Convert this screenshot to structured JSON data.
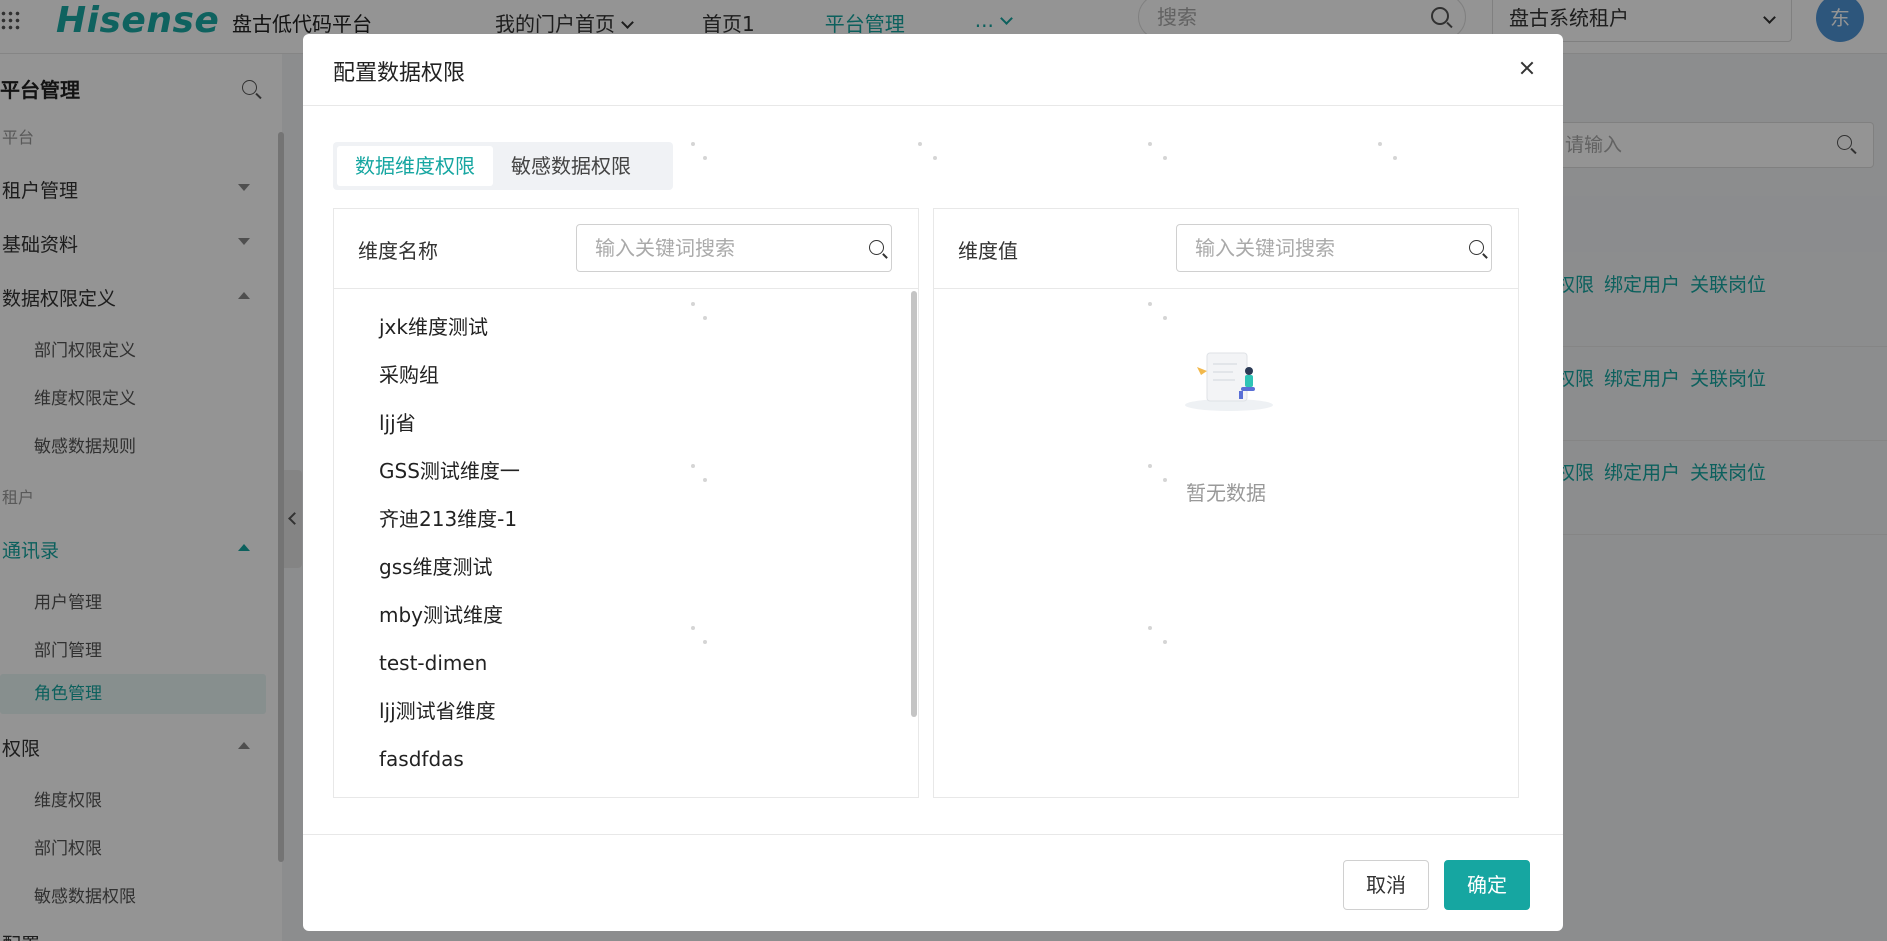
{
  "app": {
    "logo": "Hisense",
    "platform_name": "盘古低代码平台",
    "nav": [
      {
        "label": "我的门户首页",
        "has_dropdown": true,
        "active": false
      },
      {
        "label": "首页1",
        "has_dropdown": false,
        "active": false
      },
      {
        "label": "平台管理",
        "has_dropdown": false,
        "active": true
      },
      {
        "label": "...",
        "has_dropdown": true,
        "active": true
      }
    ],
    "search_placeholder": "搜索",
    "tenant": "盘古系统租户",
    "avatar": "东",
    "accent_color": "#16a6a1"
  },
  "sidebar": {
    "title": "平台管理",
    "group_platform": "平台",
    "tenant_mgmt": "租户管理",
    "basic_data": "基础资料",
    "data_perm_def": "数据权限定义",
    "dept_perm_def": "部门权限定义",
    "dim_perm_def": "维度权限定义",
    "sensitive_rule": "敏感数据规则",
    "group_tenant": "租户",
    "contacts": "通讯录",
    "user_mgmt": "用户管理",
    "dept_mgmt": "部门管理",
    "role_mgmt": "角色管理",
    "permission": "权限",
    "dim_perm": "维度权限",
    "dept_perm": "部门权限",
    "sensitive_perm": "敏感数据权限",
    "config": "配置"
  },
  "main": {
    "search_placeholder": "请输入",
    "row_actions": {
      "perm_suffix": "权限",
      "bind_user": "绑定用户",
      "link_post": "关联岗位"
    }
  },
  "dialog": {
    "title": "配置数据权限",
    "tabs": [
      "数据维度权限",
      "敏感数据权限"
    ],
    "left_panel": {
      "label": "维度名称",
      "search_placeholder": "输入关键词搜索",
      "items": [
        "jxk维度测试",
        "采购组",
        "ljj省",
        "GSS测试维度一",
        "齐迪213维度-1",
        "gss维度测试",
        "mby测试维度",
        "test-dimen",
        "ljj测试省维度",
        "fasdfdas"
      ]
    },
    "right_panel": {
      "label": "维度值",
      "search_placeholder": "输入关键词搜索",
      "empty_text": "暂无数据"
    },
    "cancel_label": "取消",
    "ok_label": "确定"
  }
}
